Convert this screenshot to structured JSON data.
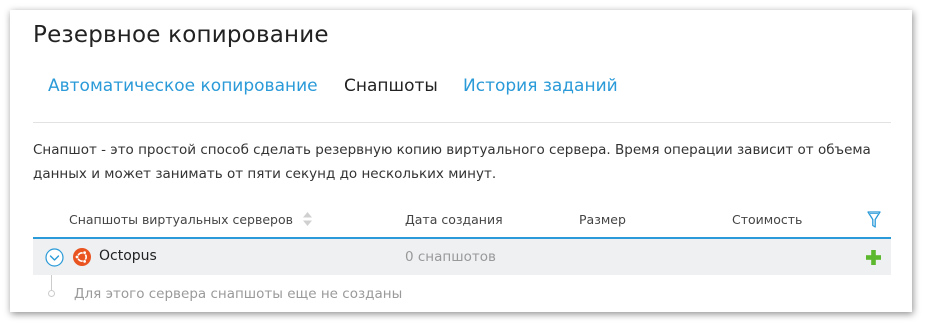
{
  "page": {
    "title": "Резервное копирование",
    "tabs": [
      {
        "label": "Автоматическое копирование",
        "active": false
      },
      {
        "label": "Снапшоты",
        "active": true
      },
      {
        "label": "История заданий",
        "active": false
      }
    ],
    "description": "Снапшот - это простой способ сделать резервную копию виртуального сервера. Время операции зависит от объема данных и может занимать от пяти секунд до нескольких минут."
  },
  "table": {
    "columns": {
      "servers": "Снапшоты виртуальных серверов",
      "created": "Дата создания",
      "size": "Размер",
      "cost": "Стоимость"
    },
    "rows": [
      {
        "os_icon": "ubuntu-icon",
        "name": "Octopus",
        "snapshots": "0 снапшотов",
        "empty_message": "Для этого сервера снапшоты еще не созданы"
      }
    ]
  },
  "colors": {
    "accent": "#2a9ad8",
    "add": "#5cb82c",
    "ubuntu": "#e95420"
  }
}
